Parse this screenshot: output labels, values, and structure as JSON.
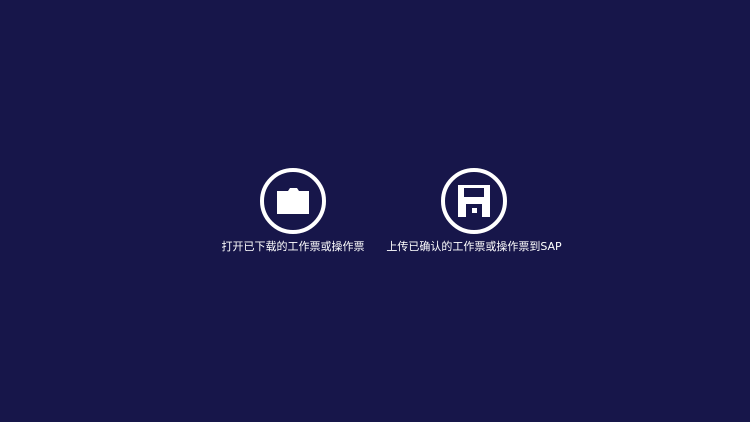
{
  "background_color": "#17164a",
  "foreground_color": "#ffffff",
  "actions": [
    {
      "label": "打开已下载的工作票或操作票",
      "icon": "folder-icon"
    },
    {
      "label": "上传已确认的工作票或操作票到SAP",
      "icon": "floppy-disk-save-icon"
    }
  ]
}
